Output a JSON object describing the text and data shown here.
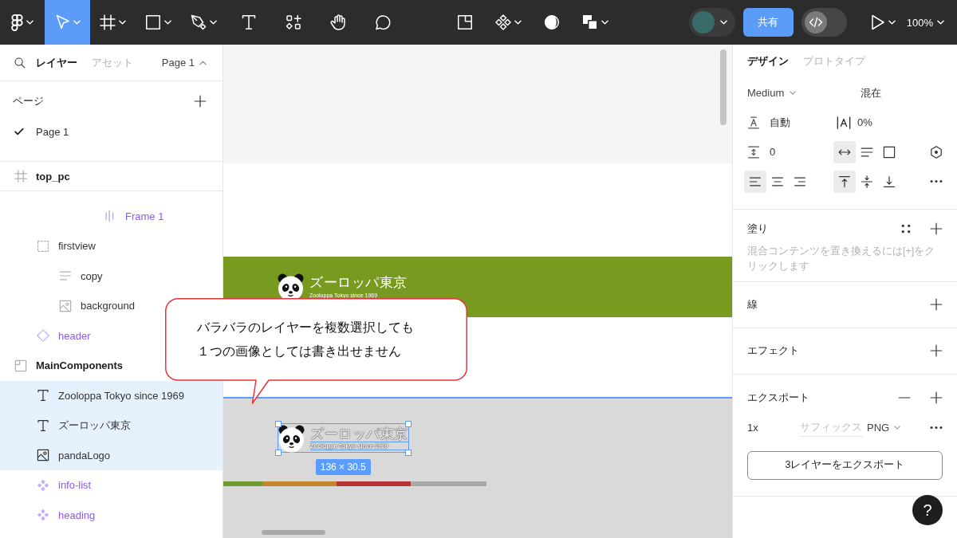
{
  "toolbar": {
    "tools": [
      {
        "kind": "main-menu",
        "selected": false,
        "dropdown": true
      },
      {
        "kind": "move",
        "selected": true,
        "dropdown": true
      },
      {
        "kind": "frame",
        "selected": false,
        "dropdown": true
      },
      {
        "kind": "shape",
        "selected": false,
        "dropdown": true
      },
      {
        "kind": "pen",
        "selected": false,
        "dropdown": true
      },
      {
        "kind": "text",
        "selected": false,
        "dropdown": false
      },
      {
        "kind": "actions",
        "selected": false,
        "dropdown": false
      },
      {
        "kind": "hand",
        "selected": false,
        "dropdown": false
      },
      {
        "kind": "comment",
        "selected": false,
        "dropdown": false
      }
    ],
    "center_tools": [
      {
        "kind": "layout",
        "dropdown": false
      },
      {
        "kind": "components",
        "dropdown": true
      },
      {
        "kind": "contrast",
        "dropdown": false
      },
      {
        "kind": "boolean",
        "dropdown": true
      }
    ],
    "share_button": "共有",
    "dev_mode": {
      "on": false
    },
    "zoom": "100%"
  },
  "left_panel": {
    "tabs": [
      {
        "label": "レイヤー",
        "selected": true
      },
      {
        "label": "アセット",
        "selected": false
      }
    ],
    "page_switcher": "Page 1",
    "pages": {
      "title": "ページ",
      "items": [
        {
          "label": "Page 1",
          "selected": true
        }
      ]
    },
    "layers": [
      {
        "label": "top_pc",
        "kind": "frame",
        "pinned": true,
        "component": false,
        "selected": false,
        "cut_branch_tail": {
          "label": "Frame 1",
          "kind": "auto-layout",
          "component": true,
          "selected": false
        },
        "children": [
          {
            "label": "firstview",
            "kind": "group",
            "component": false,
            "selected": false,
            "children": [
              {
                "label": "copy",
                "kind": "text-lines",
                "component": false,
                "selected": false
              },
              {
                "label": "background",
                "kind": "image",
                "component": false,
                "selected": false
              }
            ]
          },
          {
            "label": "header",
            "kind": "instance",
            "component": true,
            "selected": false
          }
        ]
      },
      {
        "label": "MainComponents",
        "kind": "section",
        "pinned": false,
        "component": false,
        "selected": false,
        "children": [
          {
            "label": "Zooloppa Tokyo since 1969",
            "kind": "text",
            "component": false,
            "selected": true
          },
          {
            "label": "ズーロッパ東京",
            "kind": "text",
            "component": false,
            "selected": true
          },
          {
            "label": "pandaLogo",
            "kind": "image",
            "component": false,
            "selected": true
          },
          {
            "label": "info-list",
            "kind": "component",
            "component": true,
            "selected": false
          },
          {
            "label": "heading",
            "kind": "component",
            "component": true,
            "selected": false
          }
        ]
      }
    ]
  },
  "canvas": {
    "header_banner": {
      "title": "ズーロッパ東京",
      "subtitle": "Zooloppa Tokyo since 1969"
    },
    "main_component": {
      "title": "ズーロッパ東京",
      "subtitle": "Zooloppa Tokyo since 1969",
      "size_label": "136 × 30.5"
    },
    "color_bar": [
      {
        "color": "#6e9a30"
      },
      {
        "color": "#c4862c"
      },
      {
        "color": "#b83434"
      },
      {
        "color": "#a9a9a9"
      }
    ],
    "callout": {
      "lines": [
        "バラバラのレイヤーを複数選択しても",
        "１つの画像としては書き出せません"
      ]
    }
  },
  "right_panel": {
    "tabs": [
      {
        "label": "デザイン",
        "selected": true
      },
      {
        "label": "プロトタイプ",
        "selected": false
      }
    ],
    "typography": {
      "font_style": "Medium",
      "font_size": "混在",
      "line_height": "自動",
      "letter_spacing": "0%",
      "paragraph_spacing": "0",
      "resizing": [
        {
          "kind": "auto-width",
          "selected": true
        },
        {
          "kind": "auto-height",
          "selected": false
        },
        {
          "kind": "fixed",
          "selected": false
        }
      ],
      "align_horizontal": [
        {
          "kind": "left",
          "selected": true
        },
        {
          "kind": "center",
          "selected": false
        },
        {
          "kind": "right",
          "selected": false
        }
      ],
      "align_vertical": [
        {
          "kind": "top",
          "selected": true
        },
        {
          "kind": "middle",
          "selected": false
        },
        {
          "kind": "bottom",
          "selected": false
        }
      ]
    },
    "fill": {
      "title": "塗り",
      "hint": "混合コンテンツを置き換えるには[+]をクリックします"
    },
    "sections": [
      {
        "title": "線"
      },
      {
        "title": "エフェクト"
      }
    ],
    "export": {
      "title": "エクスポート",
      "scale": "1x",
      "suffix": {
        "placeholder": "サフィックス"
      },
      "format": "PNG",
      "button": "3レイヤーをエクスポート"
    },
    "help_button": "?"
  }
}
